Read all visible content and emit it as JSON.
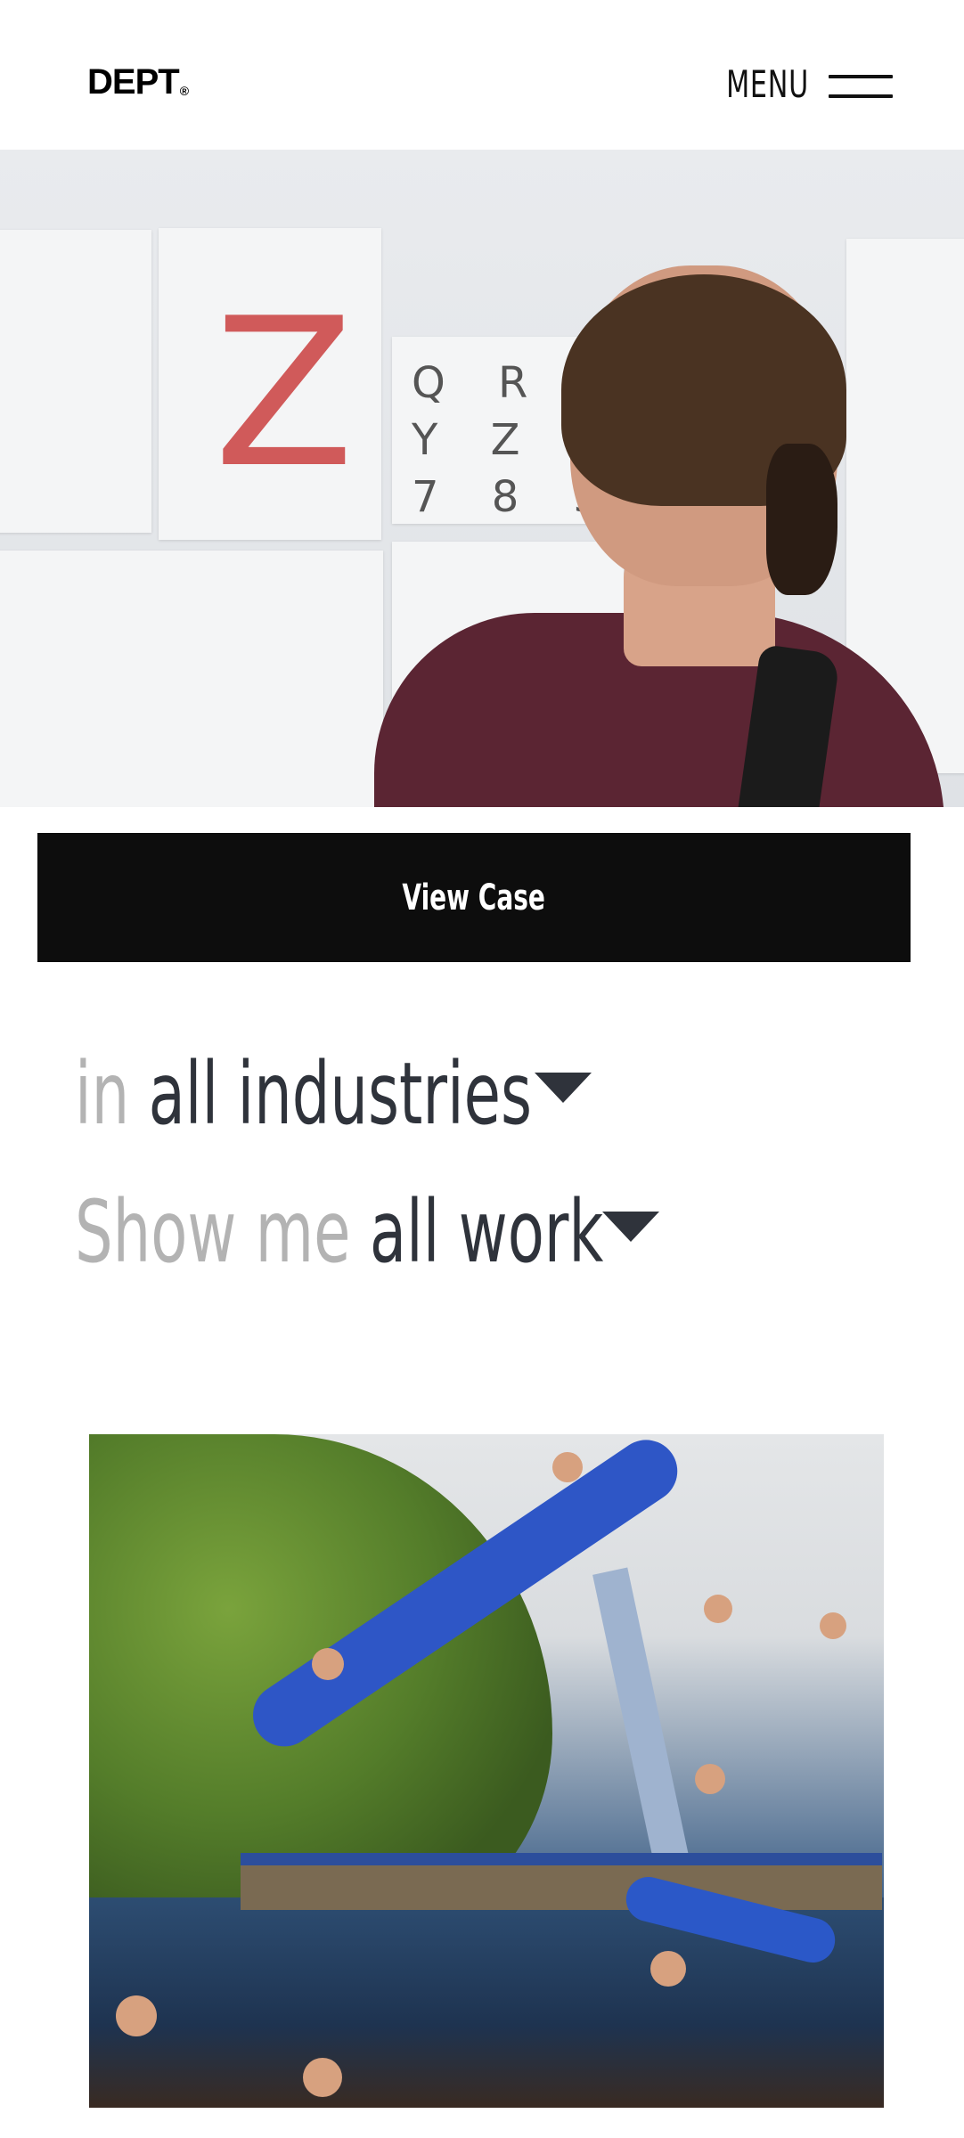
{
  "header": {
    "logo_text": "DEPT",
    "logo_mark": "®",
    "menu_label": "MENU"
  },
  "hero": {
    "wall_letter": "Z",
    "eye_chart_lines": [
      "Q R S",
      "Y Z 1",
      "7 8 9"
    ]
  },
  "cta": {
    "view_case_label": "View Case"
  },
  "filters": {
    "industries": {
      "prefix": "in",
      "value": "all industries"
    },
    "work": {
      "prefix": "Show me",
      "value": "all work"
    }
  },
  "colors": {
    "button_bg": "#0d0d0d",
    "filter_muted": "#b3b3b3",
    "filter_strong": "#2f333b"
  },
  "icons": {
    "menu": "hamburger-icon",
    "dropdown": "caret-down-icon"
  }
}
